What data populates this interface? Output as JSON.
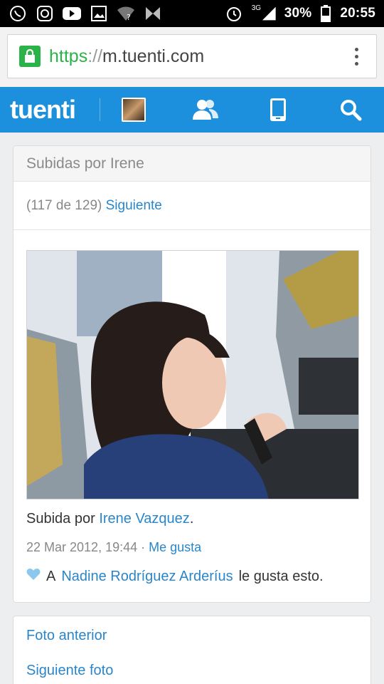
{
  "status_bar": {
    "network": "3G",
    "battery": "30%",
    "time": "20:55",
    "icons_left": [
      "whatsapp-icon",
      "instagram-icon",
      "youtube-icon",
      "gallery-icon",
      "wifi-question-icon",
      "butterfly-icon"
    ],
    "icons_right": [
      "alarm-icon",
      "signal-icon",
      "battery-icon"
    ]
  },
  "browser": {
    "url_scheme": "https",
    "url_separator": "://",
    "url_host": "m.tuenti.com"
  },
  "header": {
    "logo": "tuenti"
  },
  "card": {
    "title": "Subidas por Irene",
    "position_text": "(117 de 129)",
    "next_link": "Siguiente",
    "uploaded_by_prefix": "Subida por",
    "uploader": "Irene Vazquez",
    "uploaded_by_suffix": ".",
    "date": "22 Mar 2012, 19:44",
    "date_sep": " · ",
    "like_link": "Me gusta",
    "likes_prefix": "A",
    "liker": "Nadine Rodríguez Arderíus",
    "likes_suffix": "le gusta esto."
  },
  "nav_card": {
    "prev_photo": "Foto anterior",
    "next_photo": "Siguiente foto"
  },
  "colors": {
    "brand_blue": "#1c8fdd",
    "link_blue": "#2a86c9",
    "secure_green": "#2bb34a"
  }
}
